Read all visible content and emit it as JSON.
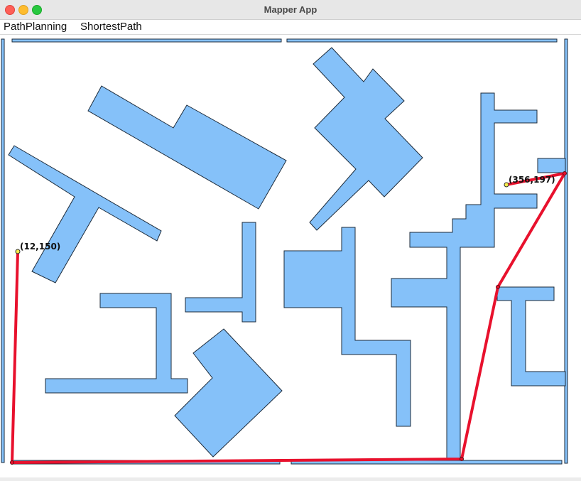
{
  "window": {
    "title": "Mapper App"
  },
  "menu": {
    "items": [
      "PathPlanning",
      "ShortestPath"
    ]
  },
  "map": {
    "start_label": "(12,150)",
    "goal_label": "(356,197)",
    "colors": {
      "obstacle_fill": "#85c1f9",
      "obstacle_stroke": "#1b2a3a",
      "path": "#e8112d",
      "endpoint": "#f5ec4a"
    }
  }
}
